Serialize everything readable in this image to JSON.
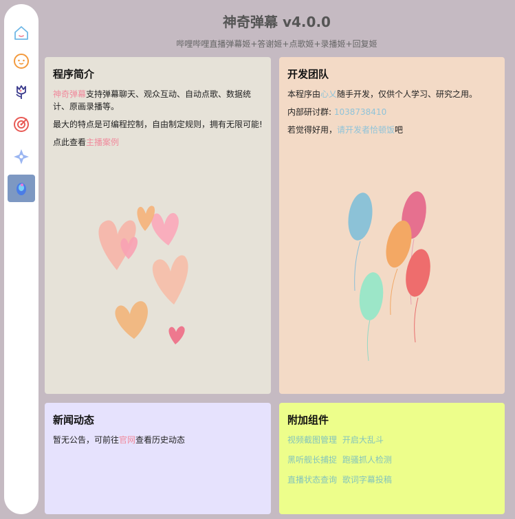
{
  "header": {
    "title": "神奇弹幕 v4.0.0",
    "subtitle": "哔哩哔哩直播弹幕姬+答谢姬+点歌姬+录播姬+回复姬"
  },
  "sidebar": {
    "items": [
      {
        "icon": "home-icon",
        "color": "#6fb7e6"
      },
      {
        "icon": "chat-icon",
        "color": "#f39a3d"
      },
      {
        "icon": "flower-icon",
        "color": "#3a3a8c"
      },
      {
        "icon": "target-icon",
        "color": "#e85a55"
      },
      {
        "icon": "star-icon",
        "color": "#9bb6f2"
      },
      {
        "icon": "planet-icon",
        "color": "#4a7ce6",
        "active": true
      }
    ]
  },
  "intro": {
    "title": "程序简介",
    "p1_link": "神奇弹幕",
    "p1_text": "支持弹幕聊天、观众互动、自动点歌、数据统计、原画录播等。",
    "p2": "最大的特点是可编程控制，自由制定规则，拥有无限可能!",
    "p3_prefix": "点此查看",
    "p3_link": "主播案例"
  },
  "team": {
    "title": "开发团队",
    "p1_prefix": "本程序由",
    "p1_link": "心乂",
    "p1_suffix": "随手开发，仅供个人学习、研究之用。",
    "p2_prefix": "内部研讨群: ",
    "p2_link": "1038738410",
    "p3_prefix": "若觉得好用，",
    "p3_link": "请开发者恰顿饭",
    "p3_suffix": "吧"
  },
  "news": {
    "title": "新闻动态",
    "text_prefix": "暂无公告，可前往",
    "text_link": "官网",
    "text_suffix": "查看历史动态"
  },
  "addons": {
    "title": "附加组件",
    "rows": [
      [
        "视频截图管理",
        "开启大乱斗"
      ],
      [
        "黑听舰长捕捉",
        "跑骚抓人检测"
      ],
      [
        "直播状态查询",
        "歌词字幕投稿"
      ]
    ]
  },
  "colors": {
    "background": "#c5bac2",
    "intro_card": "#e6e2d8",
    "team_card": "#f3dac6",
    "news_card": "#e6e2fd",
    "addon_card": "#edfe8b",
    "link_pink": "#f08a9c",
    "link_blue": "#8fc3d9"
  }
}
